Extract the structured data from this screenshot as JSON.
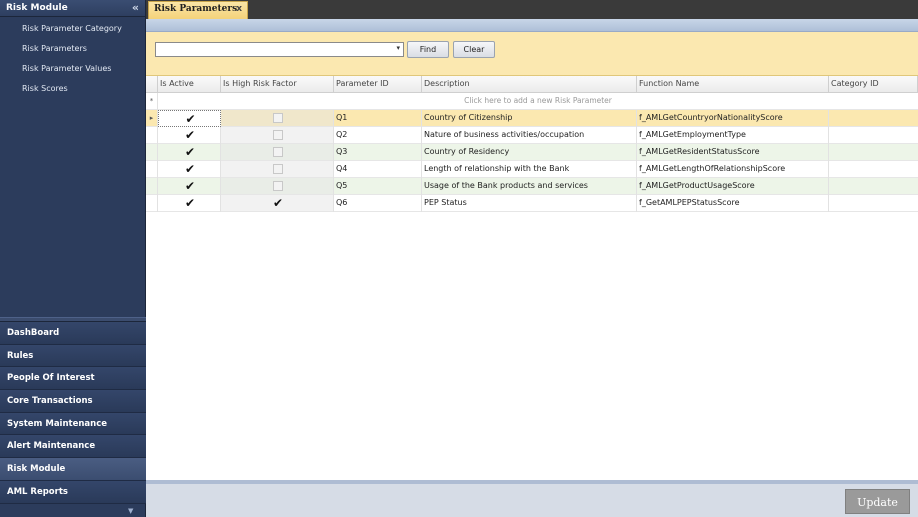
{
  "sidebar": {
    "header": "Risk Module",
    "collapse_icon": "«",
    "module_items": [
      {
        "label": "Risk Parameter Category"
      },
      {
        "label": "Risk Parameters"
      },
      {
        "label": "Risk Parameter Values"
      },
      {
        "label": "Risk Scores"
      }
    ],
    "nav_groups": [
      {
        "label": "DashBoard"
      },
      {
        "label": "Rules"
      },
      {
        "label": "People Of Interest"
      },
      {
        "label": "Core Transactions"
      },
      {
        "label": "System Maintenance"
      },
      {
        "label": "Alert Maintenance"
      },
      {
        "label": "Risk Module",
        "active": true
      },
      {
        "label": "AML Reports"
      }
    ]
  },
  "tabs": [
    {
      "label": "Risk Parameters",
      "close": "x"
    }
  ],
  "filter": {
    "select_value": "",
    "dropdown_icon": "▾",
    "find_label": "Find",
    "clear_label": "Clear"
  },
  "grid": {
    "columns": [
      "",
      "Is Active",
      "Is High Risk Factor",
      "Parameter ID",
      "Description",
      "Function Name",
      "Category ID"
    ],
    "new_row_marker": "*",
    "new_row_text": "Click here to add a new Risk Parameter",
    "current_row_marker": "▸",
    "rows": [
      {
        "is_active": true,
        "is_high_risk": false,
        "param_id": "Q1",
        "description": "Country of Citizenship",
        "function": "f_AMLGetCountryorNationalityScore",
        "category_id": ""
      },
      {
        "is_active": true,
        "is_high_risk": false,
        "param_id": "Q2",
        "description": "Nature of business activities/occupation",
        "function": "f_AMLGetEmploymentType",
        "category_id": ""
      },
      {
        "is_active": true,
        "is_high_risk": false,
        "param_id": "Q3",
        "description": "Country of Residency",
        "function": "f_AMLGetResidentStatusScore",
        "category_id": ""
      },
      {
        "is_active": true,
        "is_high_risk": false,
        "param_id": "Q4",
        "description": "Length of relationship with the Bank",
        "function": "f_AMLGetLengthOfRelationshipScore",
        "category_id": ""
      },
      {
        "is_active": true,
        "is_high_risk": false,
        "param_id": "Q5",
        "description": "Usage of the Bank products and services",
        "function": "f_AMLGetProductUsageScore",
        "category_id": ""
      },
      {
        "is_active": true,
        "is_high_risk": true,
        "param_id": "Q6",
        "description": "PEP Status",
        "function": "f_GetAMLPEPStatusScore",
        "category_id": ""
      }
    ]
  },
  "footer": {
    "update_label": "Update"
  }
}
